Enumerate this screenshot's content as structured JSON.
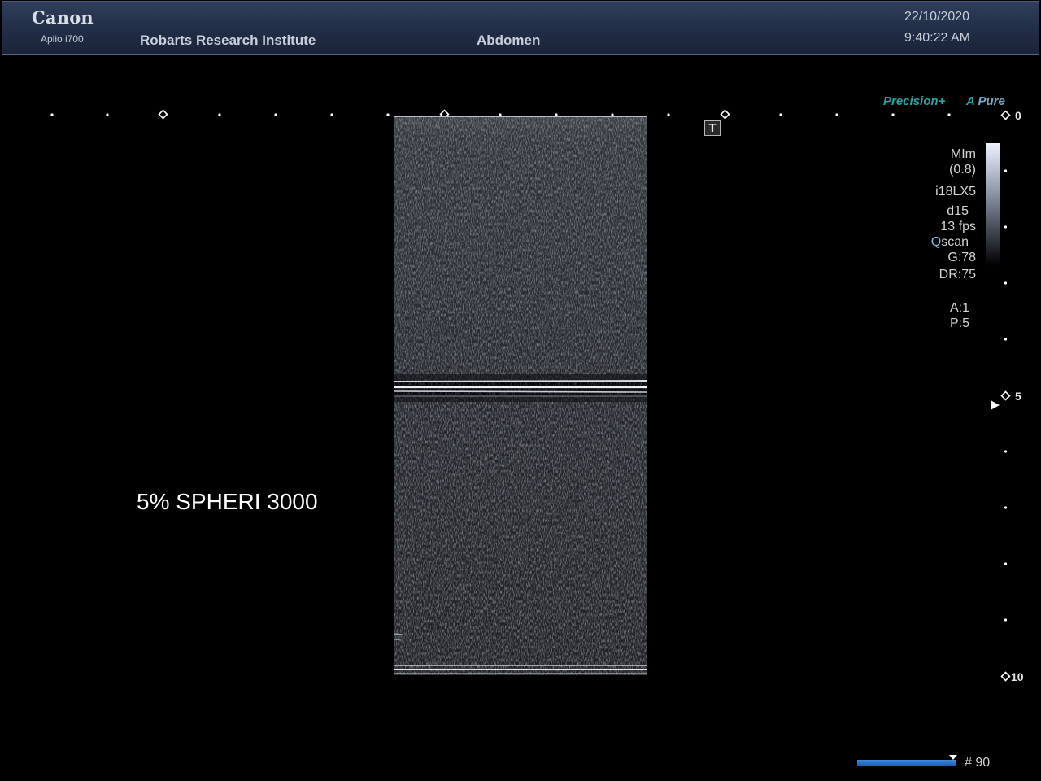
{
  "header": {
    "brand": "Canon",
    "model": "Aplio i700",
    "institute": "Robarts Research Institute",
    "preset": "Abdomen",
    "date": "22/10/2020",
    "time": "9:40:22 AM"
  },
  "logos": {
    "precision": "Precision+",
    "apure_a": "A",
    "apure_text": "Pure"
  },
  "t_marker": "T",
  "params": {
    "mode": "MIm",
    "mi": "(0.8)",
    "probe": "i18LX5",
    "depth_code": "d15",
    "fps": "13 fps",
    "qscan_q": "Q",
    "qscan_rest": "scan",
    "gain": "G:78",
    "dynamic_range": "DR:75",
    "a": "A:1",
    "p": "P:5"
  },
  "depth_scale": {
    "labels": [
      "0",
      "5",
      "10"
    ]
  },
  "annotation": "5% SPHERI 3000",
  "frame": {
    "count": "# 90"
  },
  "colors": {
    "header_bg": "#23304a",
    "accent_teal": "#2aa3a3",
    "frame_bar": "#2b72c4"
  }
}
